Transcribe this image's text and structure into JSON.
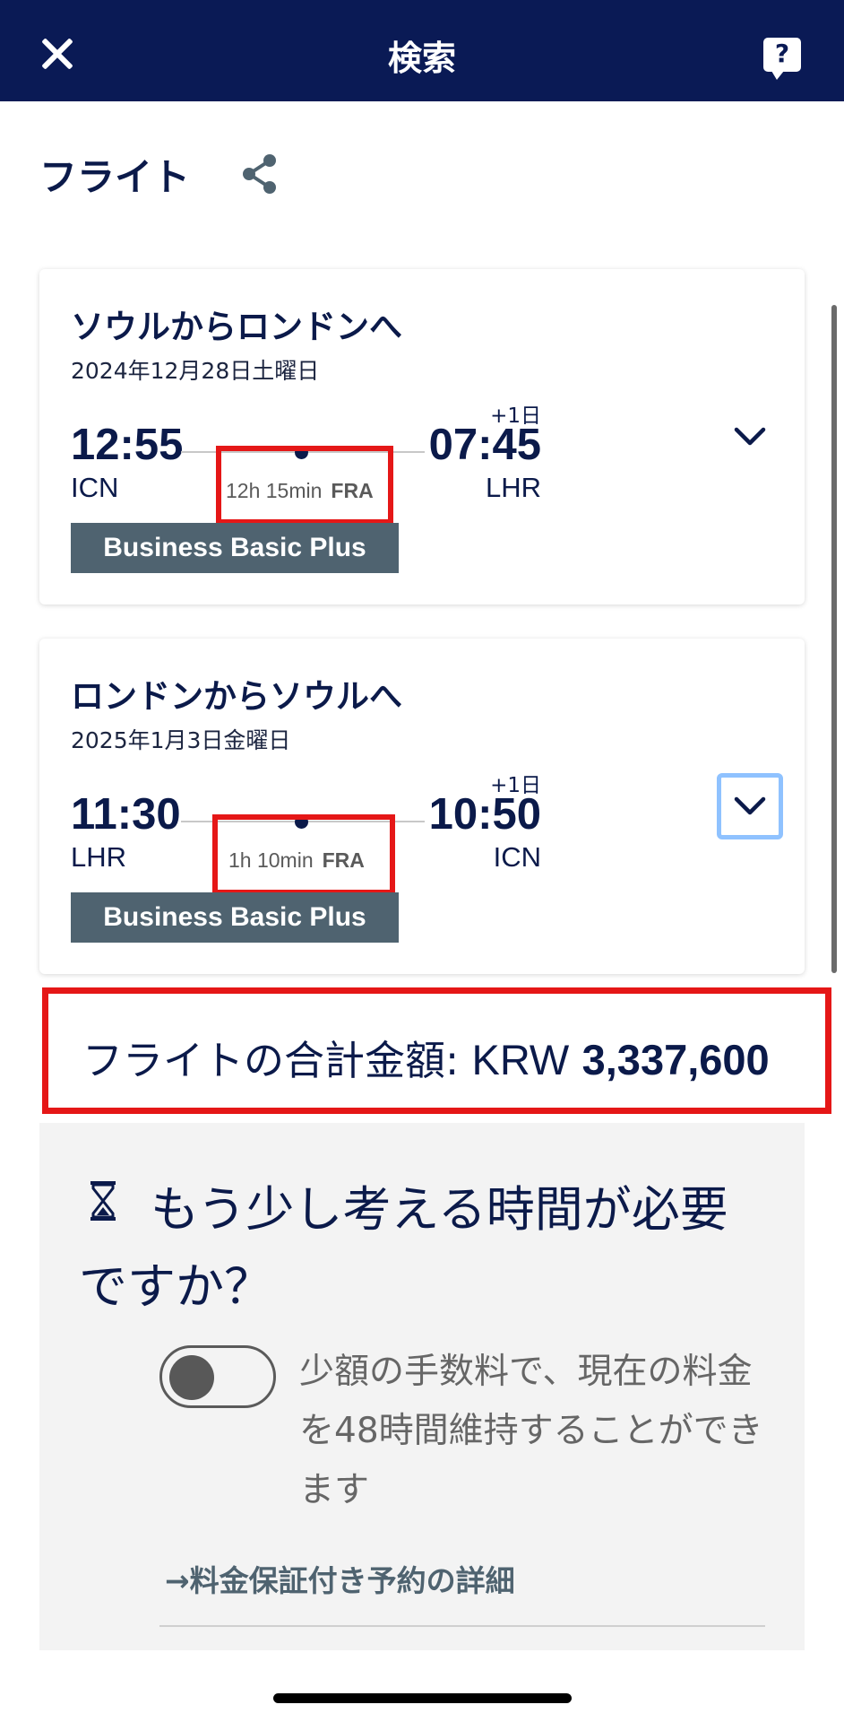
{
  "header": {
    "title": "検索",
    "close_icon": "close-icon",
    "help_icon": "help-chat-icon",
    "help_label": "?"
  },
  "section": {
    "title": "フライト",
    "share_icon": "share-icon"
  },
  "flights": [
    {
      "title": "ソウルからロンドンへ",
      "date": "2024年12月28日土曜日",
      "departure_time": "12:55",
      "departure_code": "ICN",
      "arrival_time": "07:45",
      "arrival_code": "LHR",
      "day_offset": "+1日",
      "duration": "12h 15min",
      "stop": "FRA",
      "fare_class": "Business Basic Plus",
      "expand_icon": "chevron-down-icon"
    },
    {
      "title": "ロンドンからソウルへ",
      "date": "2025年1月3日金曜日",
      "departure_time": "11:30",
      "departure_code": "LHR",
      "arrival_time": "10:50",
      "arrival_code": "ICN",
      "day_offset": "+1日",
      "duration": "1h 10min",
      "stop": "FRA",
      "fare_class": "Business Basic Plus",
      "expand_icon": "chevron-down-icon"
    }
  ],
  "total": {
    "label": "フライトの合計金額:",
    "currency": "KRW",
    "amount": "3,337,600"
  },
  "hold": {
    "icon": "hourglass-icon",
    "title": "もう少し考える時間が必要ですか？",
    "toggle_on": false,
    "description": "少額の手数料で、現在の料金を48時間維持することができます",
    "link_arrow": "→",
    "link_text": "料金保証付き予約の詳細"
  },
  "colors": {
    "header_bg": "#0a1a55",
    "text_primary": "#0b1a4a",
    "fare_badge_bg": "#4f6370",
    "highlight": "#e51717",
    "focus_ring": "#8fc2ff",
    "panel_bg": "#f3f3f3"
  }
}
